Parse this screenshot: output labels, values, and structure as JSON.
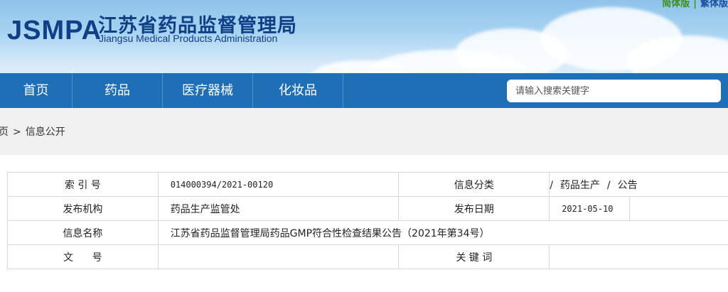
{
  "header": {
    "logo_abbr": "JSMPA",
    "logo_cn": "江苏省药品监督管理局",
    "logo_en": "Jiangsu Medical Products Administration",
    "lang_simplified": "简体版",
    "lang_separator": "|",
    "lang_traditional": "繁体版"
  },
  "nav": {
    "items": [
      "首页",
      "药品",
      "医疗器械",
      "化妆品"
    ]
  },
  "search": {
    "placeholder": "请输入搜索关键字"
  },
  "breadcrumb": {
    "home": "页",
    "separator": ">",
    "current": "信息公开"
  },
  "info": {
    "index_label": "索 引 号",
    "index_value": "014000394/2021-00120",
    "category_label": "信息分类",
    "category_path": [
      "药品生产",
      "公告"
    ],
    "category_separator": "/",
    "publisher_label": "发布机构",
    "publisher_value": "药品生产监管处",
    "date_label": "发布日期",
    "date_value": "2021-05-10",
    "title_label": "信息名称",
    "title_value": "江苏省药品监督管理局药品GMP符合性检查结果公告（2021年第34号）",
    "doc_no_label": "文      号",
    "doc_no_value": "",
    "keywords_label": "关 键 词",
    "keywords_value": ""
  },
  "colors": {
    "nav_bg": "#1e6fb5",
    "logo": "#0f3f86",
    "crumb_bg": "#f0f0f0"
  }
}
